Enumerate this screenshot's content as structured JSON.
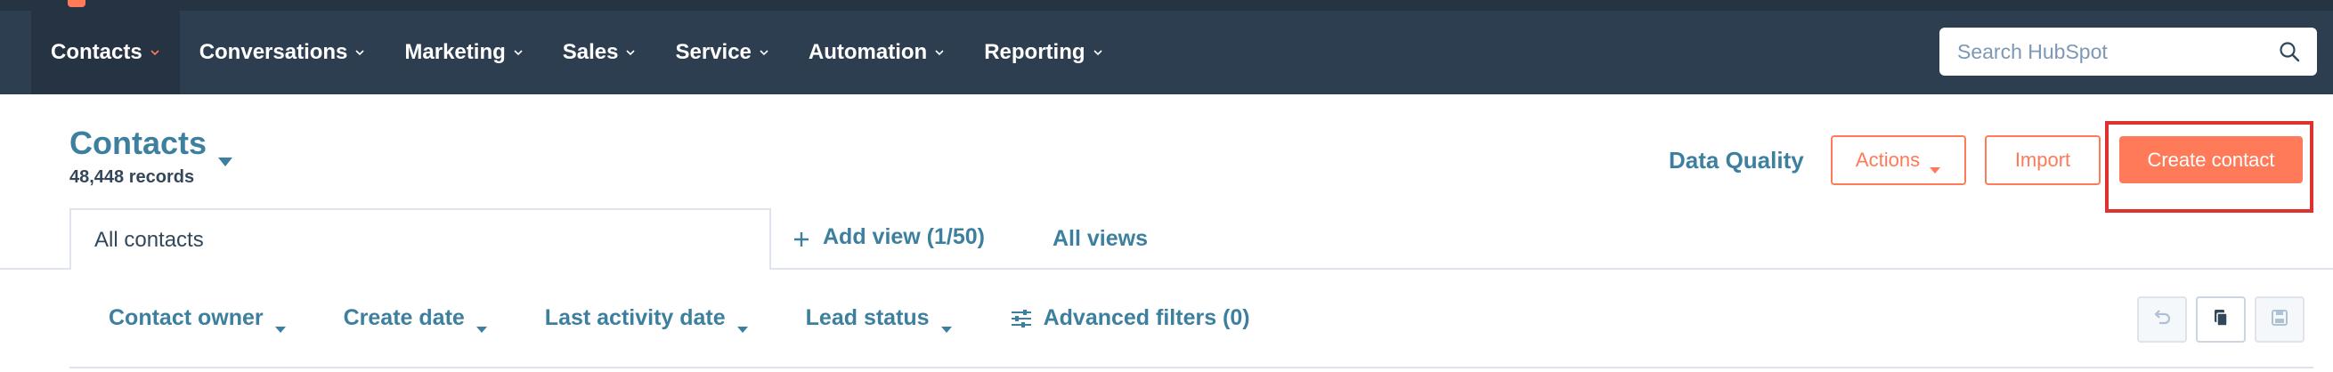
{
  "nav": {
    "items": [
      {
        "label": "Contacts",
        "active": true
      },
      {
        "label": "Conversations",
        "active": false
      },
      {
        "label": "Marketing",
        "active": false
      },
      {
        "label": "Sales",
        "active": false
      },
      {
        "label": "Service",
        "active": false
      },
      {
        "label": "Automation",
        "active": false
      },
      {
        "label": "Reporting",
        "active": false
      }
    ],
    "search_placeholder": "Search HubSpot"
  },
  "header": {
    "title": "Contacts",
    "record_count": "48,448 records",
    "data_quality_label": "Data Quality",
    "actions_label": "Actions",
    "import_label": "Import",
    "create_label": "Create contact"
  },
  "views": {
    "active_tab": "All contacts",
    "add_view_label": "Add view (1/50)",
    "all_views_label": "All views"
  },
  "filters": [
    {
      "label": "Contact owner",
      "icon": "caret-down-icon"
    },
    {
      "label": "Create date",
      "icon": "caret-down-icon"
    },
    {
      "label": "Last activity date",
      "icon": "caret-down-icon"
    },
    {
      "label": "Lead status",
      "icon": "caret-down-icon"
    },
    {
      "label": "Advanced filters (0)",
      "icon": "sliders-icon"
    }
  ],
  "view_tools": [
    "undo-icon",
    "copy-icon",
    "save-icon"
  ],
  "colors": {
    "nav_bg": "#2d3e50",
    "accent": "#ff7a59",
    "link": "#3d7f9e",
    "highlight": "#e03131"
  }
}
